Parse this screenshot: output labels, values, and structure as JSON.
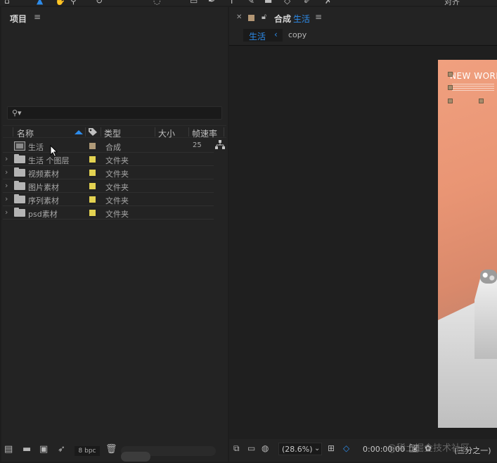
{
  "toolbar": {
    "right_label": "对齐"
  },
  "project_panel": {
    "title": "项目",
    "menu_glyph": "≡",
    "columns": {
      "name": "名称",
      "type": "类型",
      "size": "大小",
      "frame_rate": "帧速率"
    },
    "items": [
      {
        "name": "生活",
        "type": "合成",
        "frame_rate": "25",
        "icon": "composition-icon",
        "label_color": "#b09a78",
        "expandable": false
      },
      {
        "name": "生活 个图层",
        "type": "文件夹",
        "frame_rate": "",
        "icon": "folder-icon",
        "label_color": "#e3d251",
        "expandable": true
      },
      {
        "name": "视频素材",
        "type": "文件夹",
        "frame_rate": "",
        "icon": "folder-icon",
        "label_color": "#e3d251",
        "expandable": true
      },
      {
        "name": "图片素材",
        "type": "文件夹",
        "frame_rate": "",
        "icon": "folder-icon",
        "label_color": "#e3d251",
        "expandable": true
      },
      {
        "name": "序列素材",
        "type": "文件夹",
        "frame_rate": "",
        "icon": "folder-icon",
        "label_color": "#e3d251",
        "expandable": true
      },
      {
        "name": "psd素材",
        "type": "文件夹",
        "frame_rate": "",
        "icon": "folder-icon",
        "label_color": "#e3d251",
        "expandable": true
      }
    ],
    "footer": {
      "bpc": "8 bpc"
    }
  },
  "composition_panel": {
    "tab_prefix": "合成",
    "tab_name": "生活",
    "menu_glyph": "≡",
    "breadcrumb": [
      "生活",
      "copy"
    ],
    "canvas_title": "NEW WORLD",
    "zoom": "(28.6%)",
    "timecode": "0:00:00:00",
    "resolution": "(三分之一)",
    "watermark": "@稀土掘金技术社区"
  },
  "colors": {
    "accent": "#2d8ceb",
    "panel_bg": "#232323",
    "canvas_bg": "#e99574"
  }
}
